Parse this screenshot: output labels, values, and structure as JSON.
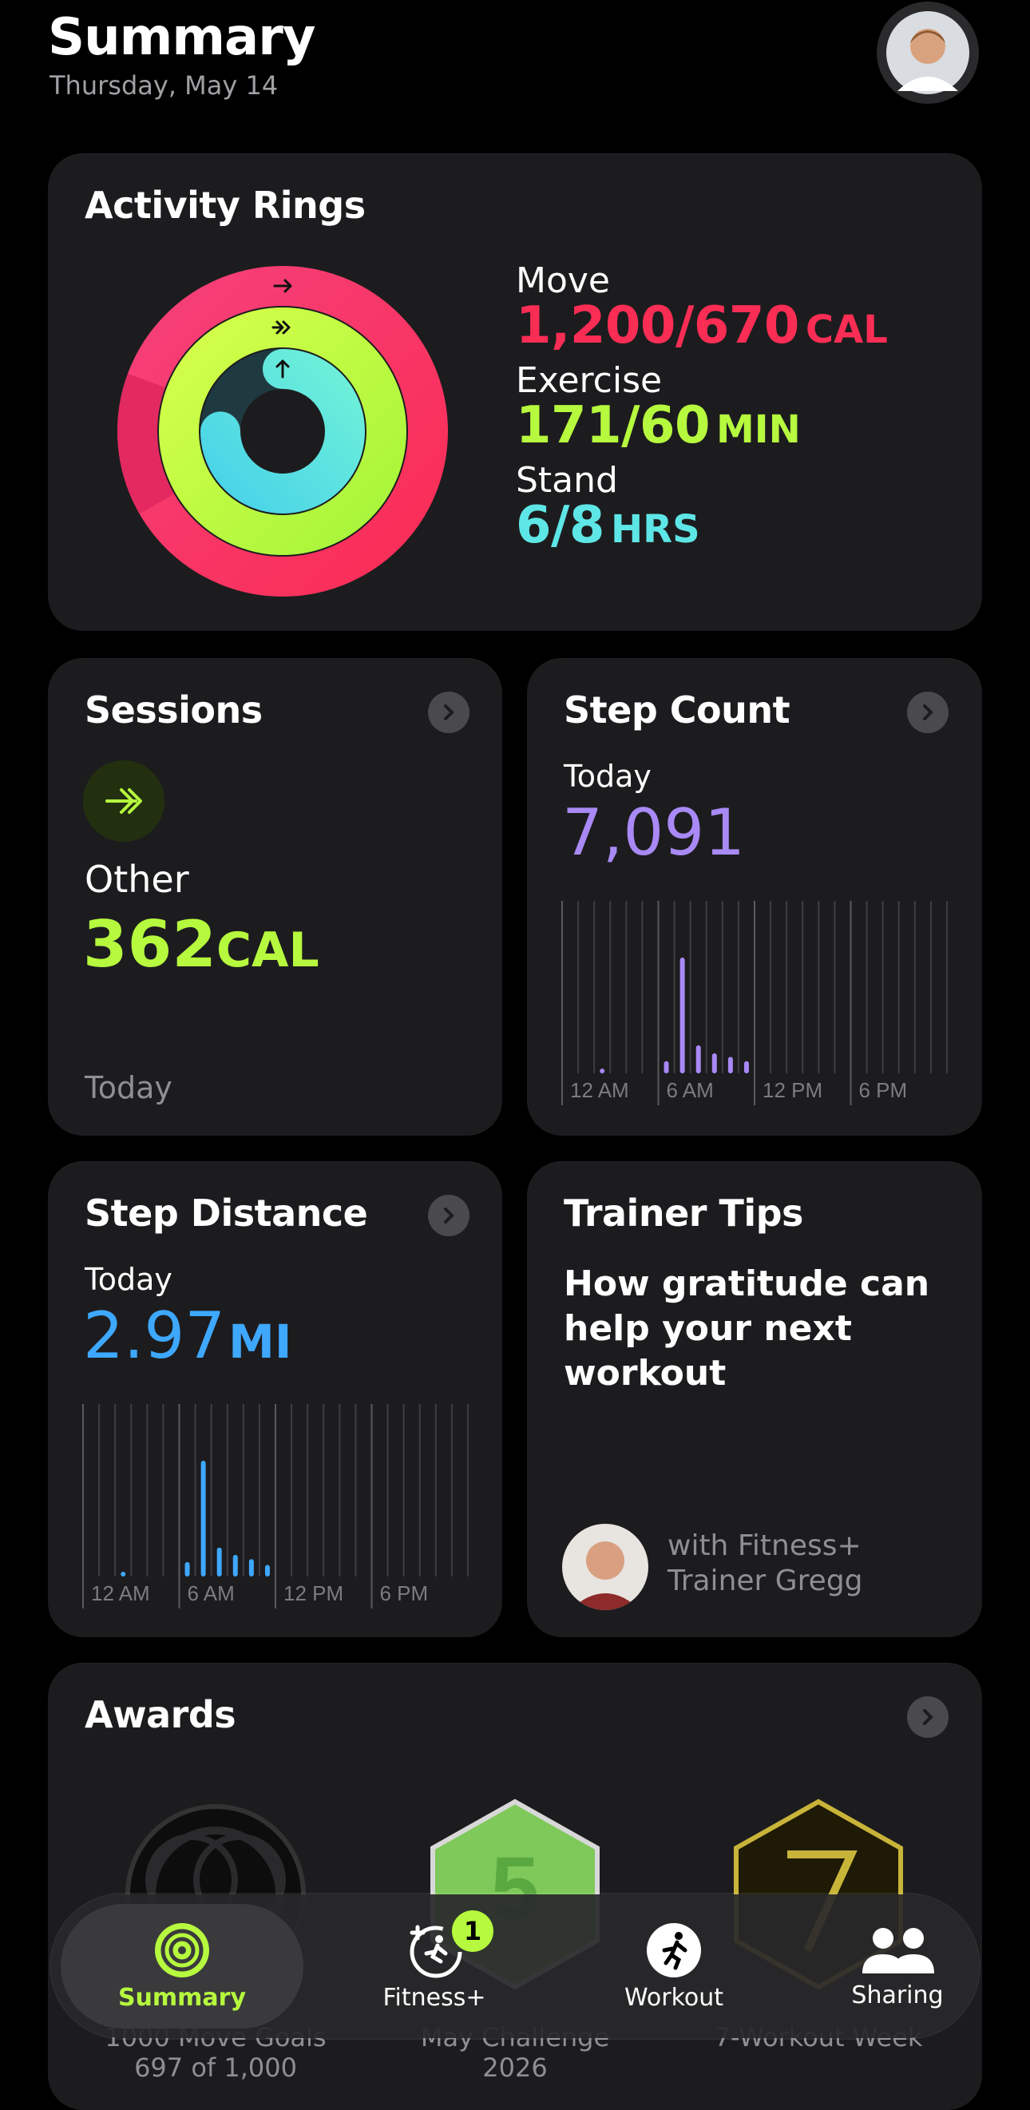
{
  "header": {
    "title": "Summary",
    "date": "Thursday, May 14"
  },
  "activity": {
    "title": "Activity Rings",
    "move": {
      "label": "Move",
      "value": "1,200/670",
      "unit": "CAL",
      "progress": 1.79,
      "color": "#fa2d55"
    },
    "exercise": {
      "label": "Exercise",
      "value": "171/60",
      "unit": "MIN",
      "progress": 2.85,
      "color": "#b6f93e"
    },
    "stand": {
      "label": "Stand",
      "value": "6/8",
      "unit": "HRS",
      "progress": 0.75,
      "color": "#5ee6e6"
    }
  },
  "sessions": {
    "title": "Sessions",
    "type": "Other",
    "value": "362",
    "unit": "CAL",
    "footer": "Today",
    "icon": "double-chevron-icon"
  },
  "step_count": {
    "title": "Step Count",
    "period": "Today",
    "value": "7,091",
    "color": "#a889f5",
    "ticks": [
      "12 AM",
      "6 AM",
      "12 PM",
      "6 PM"
    ]
  },
  "step_distance": {
    "title": "Step Distance",
    "period": "Today",
    "value": "2.97",
    "unit": "MI",
    "color": "#3ea8ff",
    "ticks": [
      "12 AM",
      "6 AM",
      "12 PM",
      "6 PM"
    ]
  },
  "trainer_tips": {
    "title": "Trainer Tips",
    "headline": "How gratitude can help your next workout",
    "trainer_line1": "with Fitness+",
    "trainer_line2": "Trainer Gregg"
  },
  "awards": {
    "title": "Awards",
    "items": [
      {
        "name": "1000 Move Goals",
        "detail": "697 of 1,000",
        "icon": "move-goals-badge-icon"
      },
      {
        "name": "May Challenge",
        "detail": "2026",
        "icon": "may-challenge-badge-icon"
      },
      {
        "name": "7-Workout Week",
        "detail": "",
        "icon": "seven-workout-badge-icon"
      }
    ]
  },
  "tabbar": {
    "summary": "Summary",
    "fitness": "Fitness+",
    "fitness_badge": "1",
    "workout": "Workout",
    "sharing": "Sharing",
    "active_color": "#b6f93e"
  },
  "chart_data": [
    {
      "type": "bar",
      "title": "Step Count",
      "x": [
        "0:00",
        "1:00",
        "2:00",
        "3:00",
        "4:00",
        "5:00",
        "6:00",
        "7:00",
        "8:00",
        "9:00",
        "10:00",
        "11:00",
        "12:00",
        "13:00",
        "14:00",
        "15:00",
        "16:00",
        "17:00",
        "18:00",
        "19:00",
        "20:00",
        "21:00",
        "22:00",
        "23:00"
      ],
      "values": [
        0,
        0,
        60,
        0,
        0,
        0,
        200,
        1900,
        460,
        330,
        270,
        200,
        0,
        0,
        0,
        0,
        0,
        0,
        0,
        0,
        0,
        0,
        0,
        0
      ],
      "xticks": [
        "12 AM",
        "6 AM",
        "12 PM",
        "6 PM"
      ]
    },
    {
      "type": "bar",
      "title": "Step Distance",
      "x": [
        "0:00",
        "1:00",
        "2:00",
        "3:00",
        "4:00",
        "5:00",
        "6:00",
        "7:00",
        "8:00",
        "9:00",
        "10:00",
        "11:00",
        "12:00",
        "13:00",
        "14:00",
        "15:00",
        "16:00",
        "17:00",
        "18:00",
        "19:00",
        "20:00",
        "21:00",
        "22:00",
        "23:00"
      ],
      "values": [
        0,
        0,
        0.03,
        0,
        0,
        0,
        0.1,
        0.8,
        0.2,
        0.15,
        0.12,
        0.08,
        0,
        0,
        0,
        0,
        0,
        0,
        0,
        0,
        0,
        0,
        0,
        0
      ],
      "xticks": [
        "12 AM",
        "6 AM",
        "12 PM",
        "6 PM"
      ]
    }
  ]
}
